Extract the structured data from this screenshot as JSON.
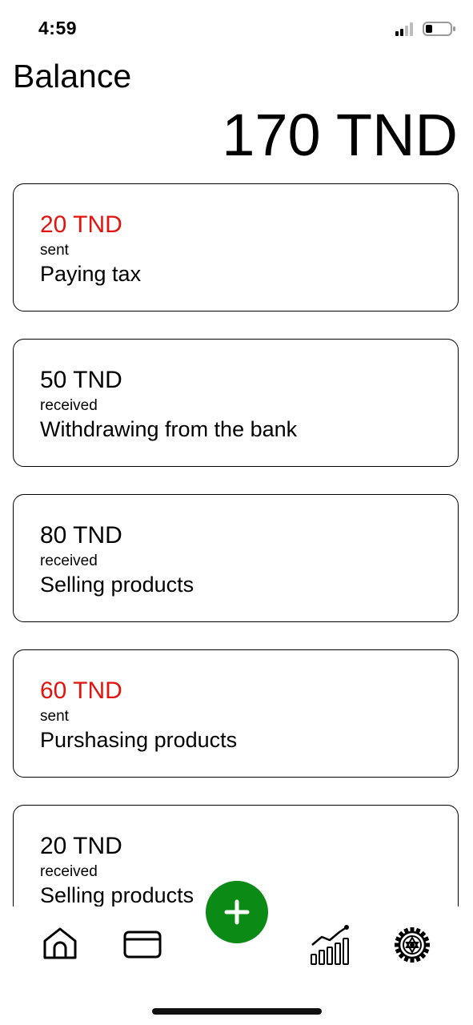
{
  "status": {
    "time": "4:59"
  },
  "header": {
    "title": "Balance",
    "balance": "170 TND"
  },
  "transactions": [
    {
      "amount": "20 TND",
      "type": "sent",
      "description": "Paying tax",
      "direction": "sent"
    },
    {
      "amount": "50 TND",
      "type": "received",
      "description": "Withdrawing from the bank",
      "direction": "received"
    },
    {
      "amount": "80 TND",
      "type": "received",
      "description": "Selling products",
      "direction": "received"
    },
    {
      "amount": "60 TND",
      "type": "sent",
      "description": "Purshasing products",
      "direction": "sent"
    },
    {
      "amount": "20 TND",
      "type": "received",
      "description": "Selling products",
      "direction": "received"
    }
  ],
  "nav": {
    "items": [
      "home-icon",
      "card-icon",
      "add-icon",
      "chart-icon",
      "settings-gear-icon"
    ],
    "fab_color": "#0b8a15"
  },
  "colors": {
    "sent": "#e3130f",
    "received": "#000000"
  }
}
